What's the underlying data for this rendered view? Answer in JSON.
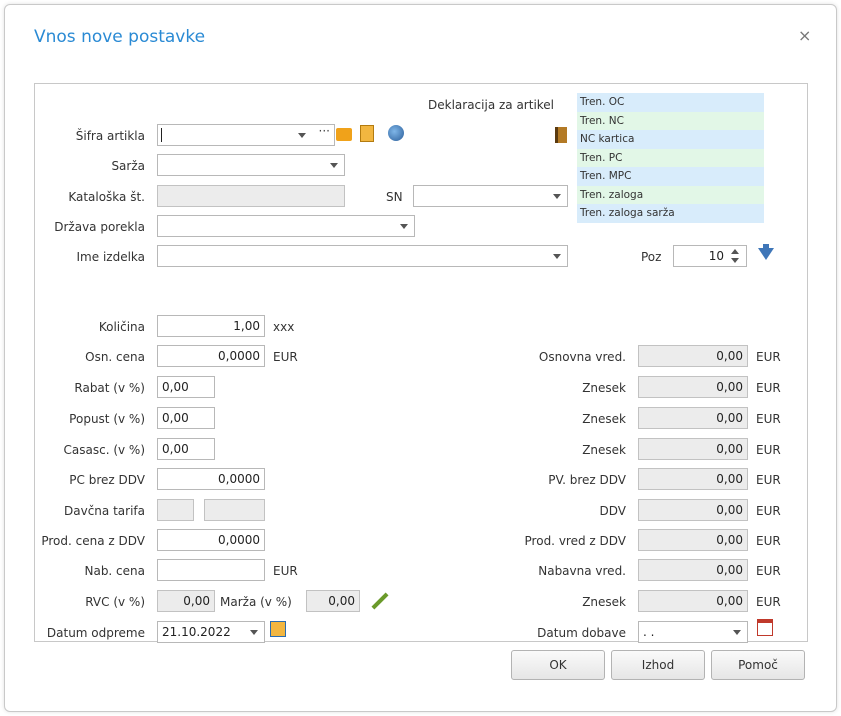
{
  "dialog": {
    "title": "Vnos nove postavke",
    "close": "×"
  },
  "header": {
    "declaration_label": "Deklaracija za artikel",
    "ellipsis": "···"
  },
  "info_list": [
    {
      "label": "Tren. OC",
      "color": "#d8ecfb"
    },
    {
      "label": "Tren. NC",
      "color": "#e2f7e7"
    },
    {
      "label": "NC kartica",
      "color": "#d8ecfb"
    },
    {
      "label": "Tren. PC",
      "color": "#e2f7e7"
    },
    {
      "label": "Tren. MPC",
      "color": "#d8ecfb"
    },
    {
      "label": "Tren. zaloga",
      "color": "#e2f7e7"
    },
    {
      "label": "Tren. zaloga sarža",
      "color": "#d8ecfb"
    }
  ],
  "fields": {
    "sifra_artikla": {
      "label": "Šifra artikla",
      "value": ""
    },
    "sarza": {
      "label": "Sarža",
      "value": ""
    },
    "kataloska": {
      "label": "Kataloška št.",
      "value": ""
    },
    "sn": {
      "label": "SN",
      "value": ""
    },
    "drzava": {
      "label": "Država porekla",
      "value": ""
    },
    "ime_izdelka": {
      "label": "Ime izdelka",
      "value": ""
    },
    "poz": {
      "label": "Poz",
      "value": "10"
    }
  },
  "left": {
    "kolicina": {
      "label": "Količina",
      "value": "1,00",
      "unit": "xxx"
    },
    "osn_cena": {
      "label": "Osn. cena",
      "value": "0,0000",
      "unit": "EUR"
    },
    "rabat": {
      "label": "Rabat (v %)",
      "value": "0,00"
    },
    "popust": {
      "label": "Popust (v %)",
      "value": "0,00"
    },
    "casasc": {
      "label": "Casasc. (v %)",
      "value": "0,00"
    },
    "pc_brez": {
      "label": "PC brez DDV",
      "value": "0,0000"
    },
    "davcna": {
      "label": "Davčna tarifa",
      "value1": "",
      "value2": ""
    },
    "prod_cena": {
      "label": "Prod. cena z DDV",
      "value": "0,0000"
    },
    "nab_cena": {
      "label": "Nab. cena",
      "value": "",
      "unit": "EUR"
    },
    "rvc": {
      "label": "RVC (v %)",
      "value": "0,00"
    },
    "marza": {
      "label": "Marža (v %)",
      "value": "0,00"
    },
    "datum_odpreme": {
      "label": "Datum odpreme",
      "value": "21.10.2022"
    }
  },
  "right": {
    "osnovna_vred": {
      "label": "Osnovna vred.",
      "value": "0,00",
      "unit": "EUR"
    },
    "znesek1": {
      "label": "Znesek",
      "value": "0,00",
      "unit": "EUR"
    },
    "znesek2": {
      "label": "Znesek",
      "value": "0,00",
      "unit": "EUR"
    },
    "znesek3": {
      "label": "Znesek",
      "value": "0,00",
      "unit": "EUR"
    },
    "pv_brez": {
      "label": "PV. brez DDV",
      "value": "0,00",
      "unit": "EUR"
    },
    "ddv": {
      "label": "DDV",
      "value": "0,00",
      "unit": "EUR"
    },
    "prod_vred": {
      "label": "Prod. vred z DDV",
      "value": "0,00",
      "unit": "EUR"
    },
    "nabavna_vred": {
      "label": "Nabavna vred.",
      "value": "0,00",
      "unit": "EUR"
    },
    "znesek4": {
      "label": "Znesek",
      "value": "0,00",
      "unit": "EUR"
    },
    "datum_dobave": {
      "label": "Datum dobave",
      "value": ". ."
    }
  },
  "buttons": {
    "ok": "OK",
    "izhod": "Izhod",
    "pomoc": "Pomoč"
  }
}
